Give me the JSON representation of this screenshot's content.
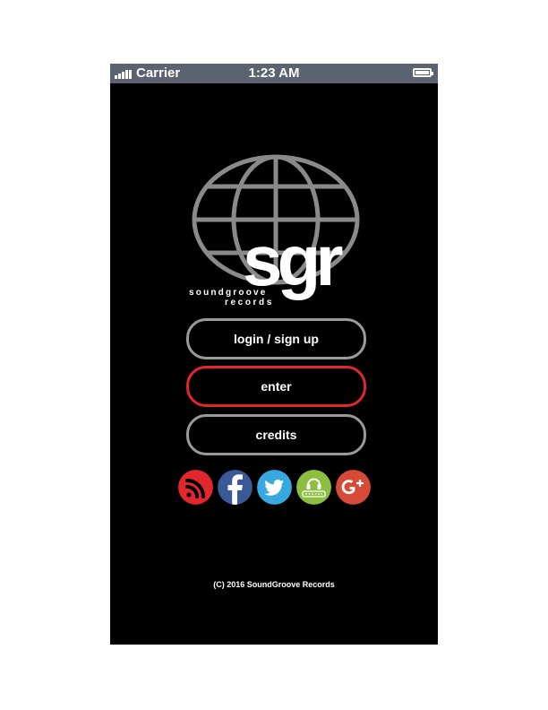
{
  "status_bar": {
    "carrier": "Carrier",
    "time": "1:23 AM"
  },
  "logo": {
    "mark": "sgr",
    "wordmark_line1": "soundgroove",
    "wordmark_line2": "records"
  },
  "buttons": {
    "login": "login / sign up",
    "enter": "enter",
    "credits": "credits"
  },
  "social": [
    {
      "name": "rss-icon",
      "color": "#e1262c"
    },
    {
      "name": "facebook-icon",
      "color": "#3b5998"
    },
    {
      "name": "twitter-icon",
      "color": "#37a9e0"
    },
    {
      "name": "beatport-icon",
      "color": "#8cbe3f"
    },
    {
      "name": "google-plus-icon",
      "color": "#d84a38"
    }
  ],
  "colors": {
    "background": "#000000",
    "status_bar": "#5b6270",
    "button_border": "#9a9a9a",
    "accent": "#e1262c"
  },
  "footer": "(C) 2016 SoundGroove Records"
}
